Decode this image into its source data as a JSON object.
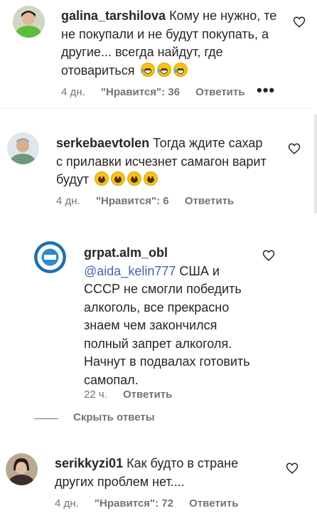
{
  "comments": [
    {
      "username": "galina_tarshilova",
      "text": "Кому не нужно, те не покупали и не будут покупать, а другие... всегда найдут, где отовариться",
      "emojis": [
        "laughing-crying-emoji",
        "laughing-crying-emoji",
        "laughing-crying-emoji"
      ],
      "time": "4 дн.",
      "likes": "\"Нравится\": 36",
      "reply": "Ответить",
      "more": "•••"
    },
    {
      "username": "serkebaevtolen",
      "text": "Тогда ждите сахар с прилавки исчезнет самагон варит будут",
      "emojis": [
        "grinning-emoji",
        "grinning-emoji",
        "grinning-emoji",
        "grinning-emoji"
      ],
      "time": "4 дн.",
      "likes": "\"Нравится\": 6",
      "reply": "Ответить"
    },
    {
      "username": "grpat.alm_obl",
      "mention": "@aida_kelin777",
      "text": "США и СССР не смогли победить алкоголь, все прекрасно знаем чем закончился полный запрет алкоголя. Начнут в подвалах готовить самопал.",
      "time": "22 ч.",
      "reply": "Ответить"
    },
    {
      "username": "serikkyzi01",
      "text": "Как будто в стране других проблем нет....",
      "time": "4 дн.",
      "likes": "\"Нравится\": 72",
      "reply": "Ответить"
    }
  ],
  "hide_replies": "Скрыть ответы",
  "colors": {
    "text": "#262626",
    "meta": "#737373",
    "mention": "#4a63a8"
  }
}
